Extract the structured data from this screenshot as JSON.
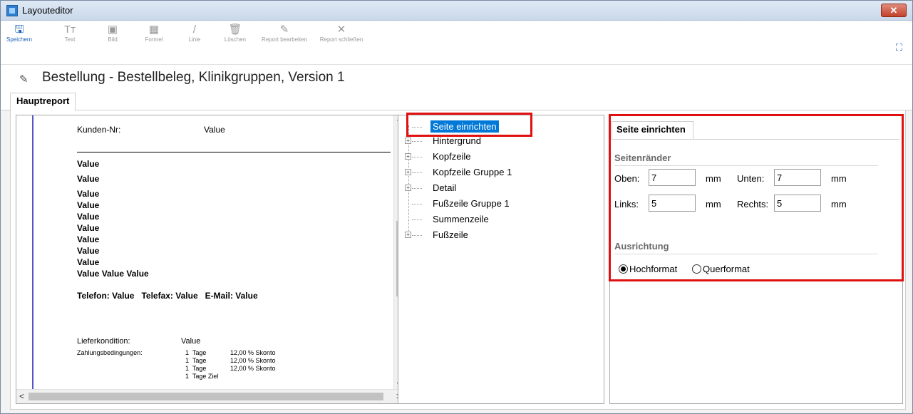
{
  "window": {
    "title": "Layouteditor",
    "close_label": "✕"
  },
  "toolbar": {
    "buttons": [
      {
        "label": "Speichern",
        "icon": "floppy-disk-icon"
      },
      {
        "label": "Text",
        "icon": "text-icon"
      },
      {
        "label": "Bild",
        "icon": "image-icon"
      },
      {
        "label": "Formel",
        "icon": "formula-icon"
      },
      {
        "label": "Linie",
        "icon": "line-icon"
      },
      {
        "label": "Löschen",
        "icon": "trash-icon"
      },
      {
        "label": "Report bearbeiten",
        "icon": "edit-pencil-icon"
      },
      {
        "label": "Report schließen",
        "icon": "close-icon"
      }
    ]
  },
  "heading": {
    "text": "Bestellung - Bestellbeleg, Klinikgruppen, Version 1"
  },
  "tabs": {
    "main": "Hauptreport"
  },
  "preview": {
    "kunden_label": "Kunden-Nr:",
    "kunden_value": "Value",
    "value_lines": [
      "Value",
      "Value",
      "Value",
      "Value",
      "Value",
      "Value",
      "Value",
      "Value",
      "Value"
    ],
    "value_triple": "Value Value Value",
    "contact_line": "Telefon: Value   Telefax: Value   E-Mail: Value",
    "liefer_label": "Lieferkondition:",
    "liefer_value": "Value",
    "zahlung_label": "Zahlungsbedingungen:",
    "zahlung_rows": [
      {
        "days": "1  Tage",
        "pct": "12,00 % Skonto"
      },
      {
        "days": "1  Tage",
        "pct": "12,00 % Skonto"
      },
      {
        "days": "1  Tage",
        "pct": "12,00 % Skonto"
      },
      {
        "days": "1  Tage Ziel",
        "pct": ""
      }
    ]
  },
  "tree": {
    "items": [
      {
        "label": "Seite einrichten",
        "selected": true,
        "expandable": false
      },
      {
        "label": "Hintergrund",
        "selected": false,
        "expandable": true
      },
      {
        "label": "Kopfzeile",
        "selected": false,
        "expandable": true
      },
      {
        "label": "Kopfzeile Gruppe 1",
        "selected": false,
        "expandable": true
      },
      {
        "label": "Detail",
        "selected": false,
        "expandable": true
      },
      {
        "label": "Fußzeile Gruppe 1",
        "selected": false,
        "expandable": false
      },
      {
        "label": "Summenzeile",
        "selected": false,
        "expandable": false
      },
      {
        "label": "Fußzeile",
        "selected": false,
        "expandable": true
      }
    ]
  },
  "props": {
    "tab_label": "Seite einrichten",
    "margins_title": "Seitenränder",
    "oben_label": "Oben:",
    "oben_value": "7",
    "unten_label": "Unten:",
    "unten_value": "7",
    "links_label": "Links:",
    "links_value": "5",
    "rechts_label": "Rechts:",
    "rechts_value": "5",
    "unit": "mm",
    "orientation_title": "Ausrichtung",
    "hochformat_label": "Hochformat",
    "querformat_label": "Querformat",
    "selected_orientation": "Hochformat"
  },
  "colors": {
    "highlight": "#e01010",
    "selection": "#0078d7",
    "accent": "#1a5fb4"
  }
}
